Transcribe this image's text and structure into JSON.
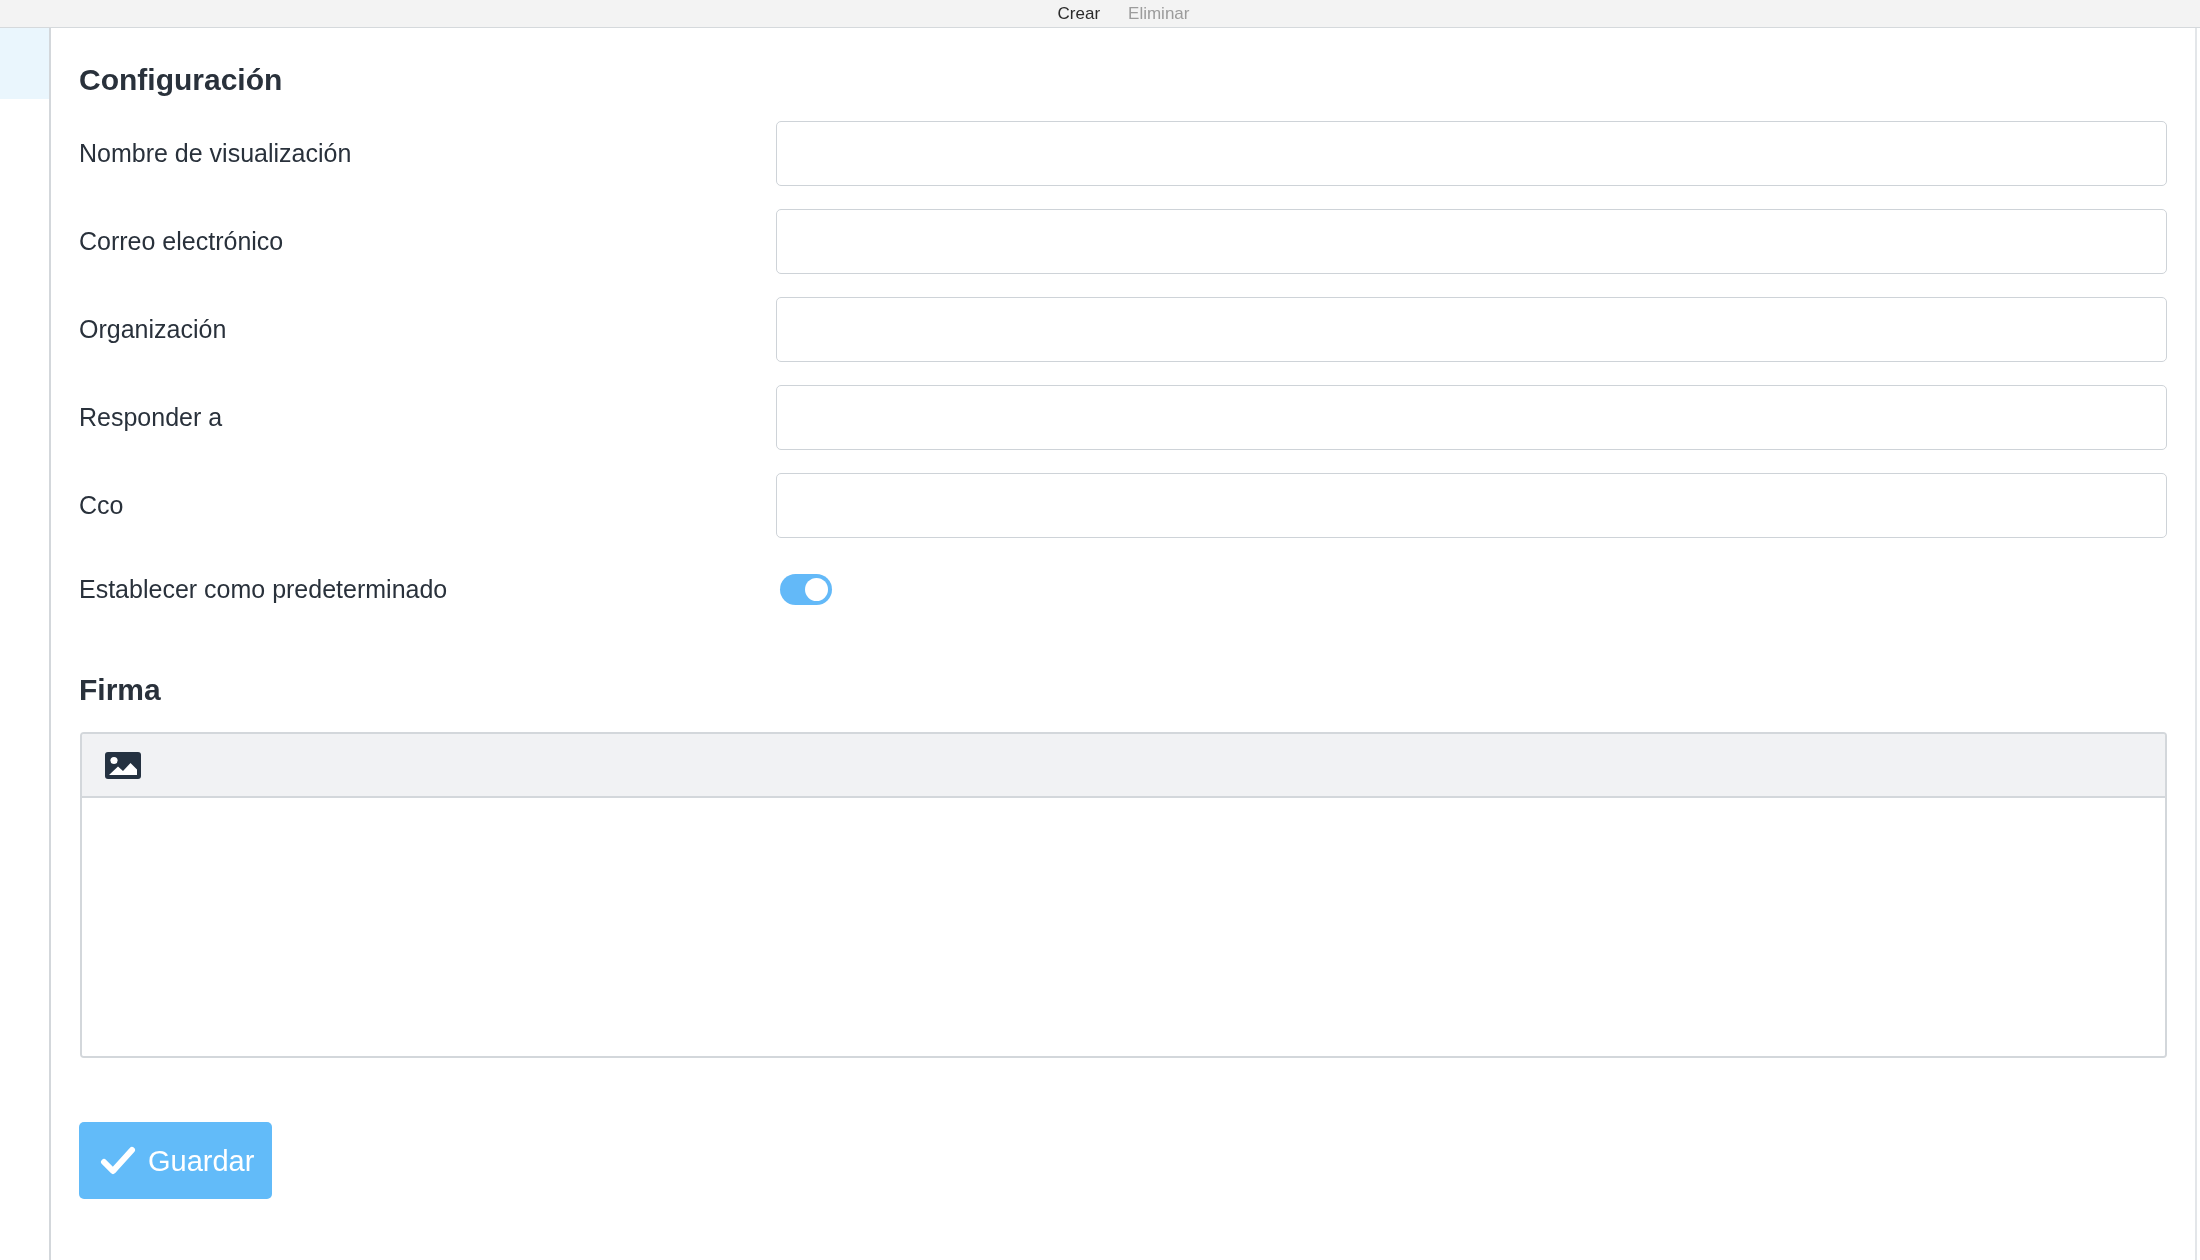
{
  "toolbar": {
    "actions": [
      {
        "label": "Crear",
        "disabled": false
      },
      {
        "label": "Eliminar",
        "disabled": true
      }
    ]
  },
  "sidebar": {
    "items": [
      {
        "selected": true
      }
    ]
  },
  "settings": {
    "title": "Configuración",
    "fields": [
      {
        "kind": "text",
        "label": "Nombre de visualización"
      },
      {
        "kind": "text",
        "label": "Correo electrónico"
      },
      {
        "kind": "text",
        "label": "Organización"
      },
      {
        "kind": "text",
        "label": "Responder a"
      },
      {
        "kind": "text",
        "label": "Cco"
      },
      {
        "kind": "toggle",
        "label": "Establecer como predeterminado",
        "on": true
      }
    ]
  },
  "signature": {
    "title": "Firma"
  },
  "save_button": {
    "label": "Guardar"
  }
}
